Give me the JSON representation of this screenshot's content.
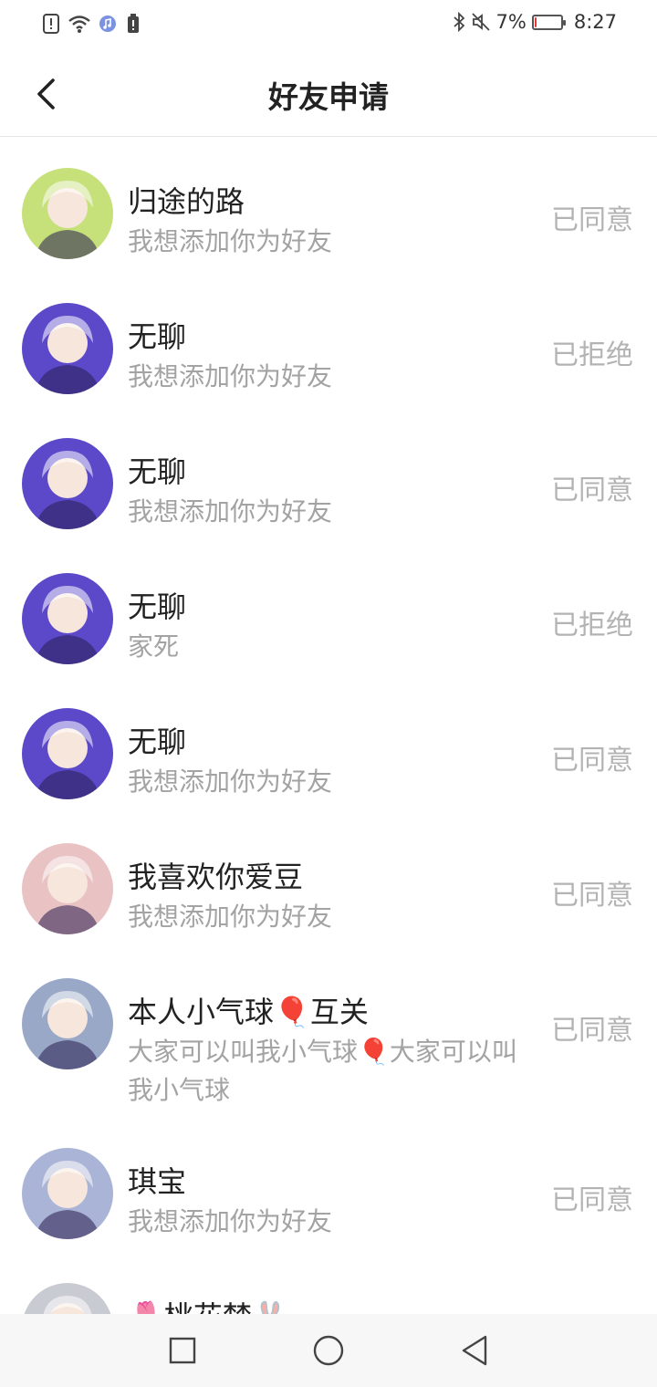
{
  "status_bar": {
    "icons_left": [
      "alert-icon",
      "wifi-icon",
      "music-icon",
      "battery-alert-icon"
    ],
    "icons_right": [
      "bluetooth-icon",
      "mute-icon"
    ],
    "battery_percent_text": "7%",
    "battery_level": 0.07,
    "time": "8:27"
  },
  "header": {
    "title": "好友申请",
    "back_icon": "chevron-left-icon"
  },
  "requests": [
    {
      "name": "归途的路",
      "message": "我想添加你为好友",
      "status": "已同意",
      "avatar": "green-hair-avatar",
      "avatar_color": "#c6e07a"
    },
    {
      "name": "无聊",
      "message": "我想添加你为好友",
      "status": "已拒绝",
      "avatar": "purple-avatar",
      "avatar_color": "#5b49c9"
    },
    {
      "name": "无聊",
      "message": "我想添加你为好友",
      "status": "已同意",
      "avatar": "purple-avatar",
      "avatar_color": "#5b49c9"
    },
    {
      "name": "无聊",
      "message": "家死",
      "status": "已拒绝",
      "avatar": "purple-avatar",
      "avatar_color": "#5b49c9"
    },
    {
      "name": "无聊",
      "message": "我想添加你为好友",
      "status": "已同意",
      "avatar": "purple-avatar",
      "avatar_color": "#5b49c9"
    },
    {
      "name": "我喜欢你爱豆",
      "message": "我想添加你为好友",
      "status": "已同意",
      "avatar": "pink-hair-avatar",
      "avatar_color": "#e9c2c4"
    },
    {
      "name": "本人小气球🎈互关",
      "message": "大家可以叫我小气球🎈大家可以叫我小气球",
      "status": "已同意",
      "avatar": "dark-hair-avatar",
      "avatar_color": "#9aa8c8"
    },
    {
      "name": "琪宝",
      "message": "我想添加你为好友",
      "status": "已同意",
      "avatar": "silver-hair-avatar",
      "avatar_color": "#aab4d6"
    },
    {
      "name": "🌷桃花梦🐰",
      "message": "",
      "status": "",
      "avatar": "grey-hair-avatar",
      "avatar_color": "#c9cbd2"
    }
  ],
  "nav_bar": {
    "buttons": [
      "square-icon",
      "circle-icon",
      "triangle-back-icon"
    ]
  }
}
